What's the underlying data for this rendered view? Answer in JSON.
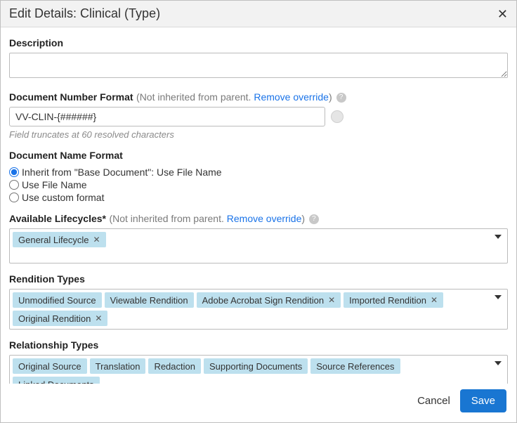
{
  "header": {
    "title": "Edit Details: Clinical (Type)"
  },
  "description": {
    "label": "Description",
    "value": ""
  },
  "docNumberFormat": {
    "label": "Document Number Format",
    "inheritNote": "(Not inherited from parent. ",
    "removeLink": "Remove override",
    "closeParen": ")",
    "value": "VV-CLIN-{######}",
    "truncNote": "Field truncates at 60 resolved characters"
  },
  "docNameFormat": {
    "label": "Document Name Format",
    "options": [
      "Inherit from \"Base Document\": Use File Name",
      "Use File Name",
      "Use custom format"
    ]
  },
  "lifecycles": {
    "label": "Available Lifecycles*",
    "inheritNote": "(Not inherited from parent. ",
    "removeLink": "Remove override",
    "closeParen": ")",
    "tags": [
      {
        "label": "General Lifecycle",
        "removable": true
      }
    ]
  },
  "renditionTypes": {
    "label": "Rendition Types",
    "tags": [
      {
        "label": "Unmodified Source",
        "removable": false
      },
      {
        "label": "Viewable Rendition",
        "removable": false
      },
      {
        "label": "Adobe Acrobat Sign Rendition",
        "removable": true
      },
      {
        "label": "Imported Rendition",
        "removable": true
      },
      {
        "label": "Original Rendition",
        "removable": true
      }
    ]
  },
  "relationshipTypes": {
    "label": "Relationship Types",
    "tags": [
      {
        "label": "Original Source",
        "removable": false
      },
      {
        "label": "Translation",
        "removable": false
      },
      {
        "label": "Redaction",
        "removable": false
      },
      {
        "label": "Supporting Documents",
        "removable": false
      },
      {
        "label": "Source References",
        "removable": false
      },
      {
        "label": "Linked Documents",
        "removable": false
      }
    ]
  },
  "footer": {
    "cancel": "Cancel",
    "save": "Save"
  }
}
